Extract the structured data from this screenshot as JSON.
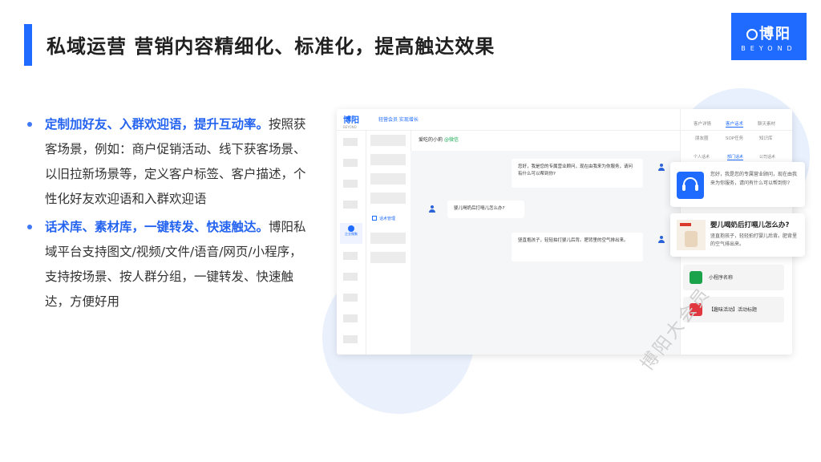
{
  "slide": {
    "title": "私域运营 营销内容精细化、标准化，提高触达效果",
    "logo": {
      "main": "博阳",
      "sub": "BEYOND"
    }
  },
  "bullets": [
    {
      "highlight": "定制加好友、入群欢迎语，提升互动率。",
      "text": "按照获客场景，例如：商户促销活动、线下获客场景、以旧拉新场景等，定义客户标签、客户描述，个性化好友欢迎语和入群欢迎语"
    },
    {
      "highlight": "话术库、素材库，一键转发、快速触达。",
      "text": "博阳私域平台支持图文/视频/文件/语音/网页/小程序，支持按场景、按人群分组，一键转发、快速触达，方便好用"
    }
  ],
  "mock": {
    "brand": "博阳",
    "brand_sub": "BEYOND",
    "slogan": "轻营会员 实现增长",
    "nav_active_label": "企业微聚",
    "subnav_active_label": "话术管理",
    "chat_title_prefix": "爱吃的小莉",
    "chat_title_tag": "@微信",
    "messages": {
      "agent_greeting": "您好，我是您的专属营业顾问，现在由我来为你服务，请问有什么可以帮到你?",
      "customer_question": "婴儿喝奶后打嗝儿怎么办?",
      "agent_answer": "竖直抱孩子，轻轻拍打婴儿后背。肥背里的空气排出来。"
    },
    "tabs_row1": [
      "客户详情",
      "客户话术",
      "聊天素材"
    ],
    "tabs_row2": [
      "朋友圈",
      "SOP任务",
      "知识库"
    ],
    "tabs_row3": [
      "个人话术",
      "部门话术",
      "公司话术"
    ]
  },
  "cards": {
    "greeting_text": "您好，我是您的专属营业顾问，现在由我来为你服务，请问有什么可以帮到你?",
    "faq_title": "婴儿喝奶后打嗝儿怎么办?",
    "faq_text": "竖直抱孩子，轻轻拍打婴儿后背。肥背里的空气排出来。",
    "miniprogram_label": "小程序名称",
    "activity_label": "【趣味活动】活动标题"
  },
  "watermark": "博阳大会员",
  "colors": {
    "accent": "#1f6bff",
    "highlight_text": "#2463f0",
    "mini_green": "#1aa34a",
    "activity_red": "#e0383e"
  }
}
